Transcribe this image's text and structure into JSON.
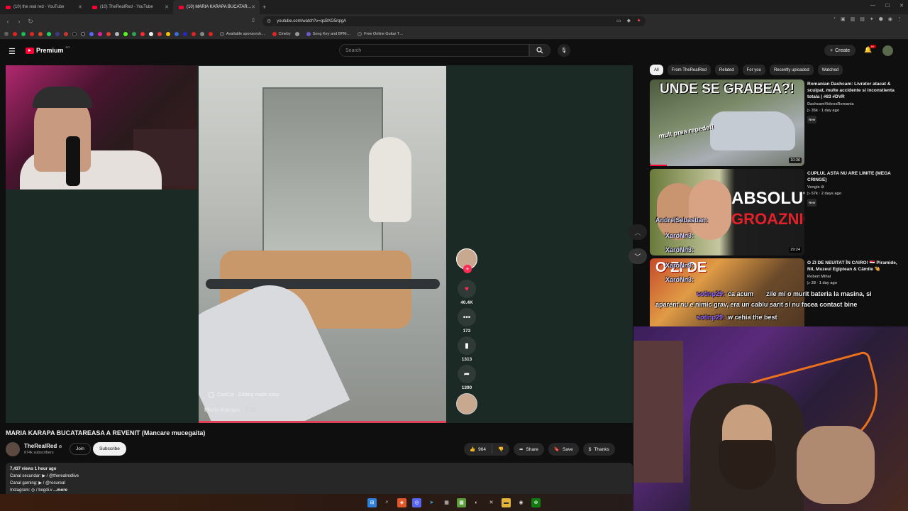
{
  "browser": {
    "tabs": [
      {
        "label": "(10) the real red - YouTube",
        "active": false
      },
      {
        "label": "(10) TheRealRed - YouTube",
        "active": false
      },
      {
        "label": "(10) MARIA KARAPA BUCATAR…",
        "active": true
      }
    ],
    "url": "youtube.com/watch?v=qcBXG5rqigA",
    "bookmarks": [
      {
        "label": "Available sponsorsh…"
      },
      {
        "label": "Cineby"
      },
      {
        "label": "Song Key and BPM…"
      },
      {
        "label": "Free Online Guitar T…"
      }
    ]
  },
  "header": {
    "logo_text": "Premium",
    "logo_region": "RO",
    "search_placeholder": "Search",
    "create_label": "Create",
    "notification_count": "9+"
  },
  "tiktok": {
    "capcut": "CapCut · Editing made easy",
    "username": "Maria Karapa",
    "date": " · 5-31",
    "likes": "40.4K",
    "comments": "172",
    "saves": "1313",
    "shares": "1390"
  },
  "video": {
    "title": "MARIA KARAPA BUCATAREASA A REVENIT (Mancare mucegaita)",
    "channel": "TheRealRed",
    "subscribers": "674k subscribers",
    "join_label": "Join",
    "subscribe_label": "Subscribe",
    "likes": "964",
    "share_label": "Share",
    "save_label": "Save",
    "thanks_label": "Thanks",
    "description": {
      "meta": "7,437 views  1 hour ago",
      "line1": "Canal secundar:  ▶ / @therealredlive",
      "line2": "Canal gaming:  ▶ / @rosureal",
      "line3": "Instagram:  ◎ / bogdi.v",
      "more": "...more"
    }
  },
  "sidebar": {
    "chips": [
      "All",
      "From TheRealRed",
      "Related",
      "For you",
      "Recently uploaded",
      "Watched"
    ],
    "recommendations": [
      {
        "thumb_text": "UNDE SE GRABEA?!",
        "thumb_sub": "mult prea repede!!",
        "duration": "10:36",
        "title": "Romanian Dashcam: Livrator atacat & scuipat, multe accidente si inconstienta totala | #83 #DVR",
        "channel": "DashcamVideosRomania",
        "meta": "▷ 35k · 1 day ago",
        "badge": "New"
      },
      {
        "thumb_text": "ABSOLUT",
        "thumb_text2": "GROAZNIC",
        "duration": "29:24",
        "title": "CUPLUL ASTA NU ARE LIMITE (MEGA CRINGE)",
        "channel": "Vengie ⊘",
        "meta": "▷ 57k · 2 days ago",
        "badge": "New"
      },
      {
        "thumb_text": "O ZI DE",
        "duration": "",
        "title": "O ZI DE NEUITAT ÎN CAIRO! 🇪🇬 Piramide, Nil, Muzeul Egiptean & Cămile 🐪",
        "channel": "Robert Mihai",
        "meta": "▷ 28 · 1 day ago",
        "badge": ""
      }
    ]
  },
  "chat_overlay": {
    "names": [
      "AndreiSebastian:",
      "XaroNn3:",
      "XaroNn3:",
      "XaroNn3:",
      "XaroNn3:"
    ],
    "msg_user": "sotinp29:",
    "msg1": "ca acum",
    "msg1b": "zile mi o murit bateria la masina, si",
    "msg2": "aparent nu e nimic grav, era un cablu sarit si nu facea contact bine",
    "msg3_user": "sotinp29:",
    "msg3": "w cehia the best"
  },
  "colors": {
    "accent": "#ff0033",
    "background": "#0f0f0f",
    "chip_bg": "#272727"
  }
}
